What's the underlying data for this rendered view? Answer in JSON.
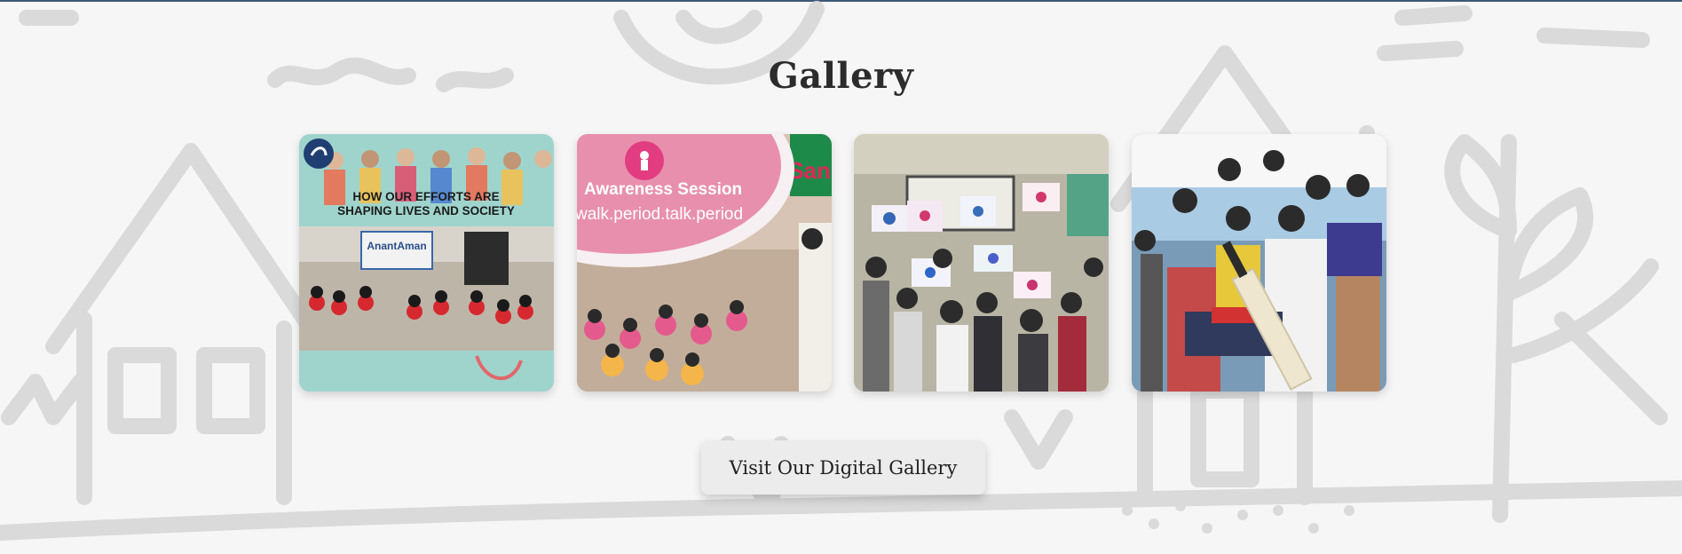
{
  "section": {
    "title": "Gallery"
  },
  "gallery": {
    "items": [
      {
        "name": "efforts-poster",
        "overlay_heading_line1": "HOW OUR EFFORTS ARE",
        "overlay_heading_line2": "SHAPING LIVES AND SOCIETY",
        "banner_text": "AnantAman"
      },
      {
        "name": "awareness-session",
        "overlay_heading": "Awareness Session",
        "overlay_tagline": "walk.period.talk.period",
        "corner_text": "Sanit"
      },
      {
        "name": "children-artwork",
        "description": ""
      },
      {
        "name": "cricket-kit-distribution",
        "description": ""
      }
    ]
  },
  "cta": {
    "label": "Visit Our Digital Gallery"
  },
  "colors": {
    "title": "#2c2c2c",
    "background": "#f6f6f7",
    "doodle": "#d9d9da",
    "button_bg": "#ececec",
    "awareness_pink": "#e8478a"
  }
}
